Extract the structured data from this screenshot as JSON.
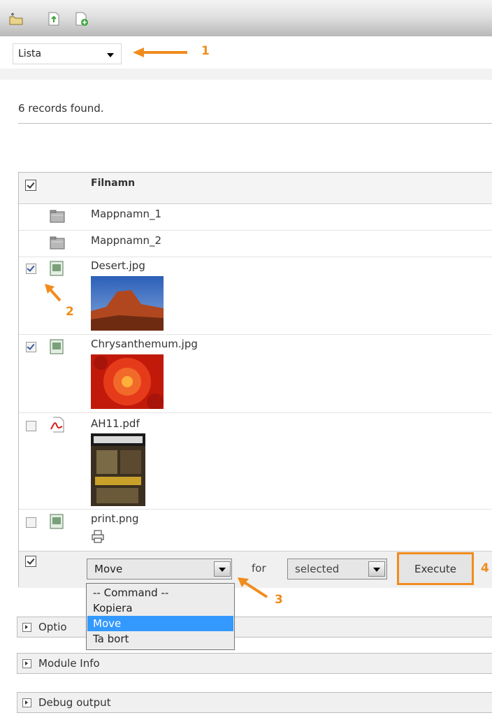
{
  "toolbar": {
    "icons": [
      "upload-folder-icon",
      "upload-file-icon",
      "new-file-icon"
    ]
  },
  "view_select": {
    "value": "Lista"
  },
  "callouts": {
    "c1": "1",
    "c2": "2",
    "c3": "3",
    "c4": "4"
  },
  "records_found": "6 records found.",
  "table": {
    "header": {
      "filename": "Filnamn"
    },
    "rows": [
      {
        "name": "Mappnamn_1",
        "type": "folder",
        "checked": false
      },
      {
        "name": "Mappnamn_2",
        "type": "folder",
        "checked": false
      },
      {
        "name": "Desert.jpg",
        "type": "image",
        "checked": true
      },
      {
        "name": "Chrysanthemum.jpg",
        "type": "image",
        "checked": true
      },
      {
        "name": "AH11.pdf",
        "type": "pdf",
        "checked": false
      },
      {
        "name": "print.png",
        "type": "image",
        "checked": false
      }
    ]
  },
  "command": {
    "selected": "Move",
    "for_label": "for",
    "scope": "selected",
    "execute_label": "Execute",
    "options": [
      "-- Command --",
      "Kopiera",
      "Move",
      "Ta bort"
    ]
  },
  "panels": {
    "options": "Optio",
    "module_info": "Module Info",
    "debug_output": "Debug output"
  },
  "colors": {
    "accent": "#f08c1e",
    "selection": "#3399ff"
  }
}
